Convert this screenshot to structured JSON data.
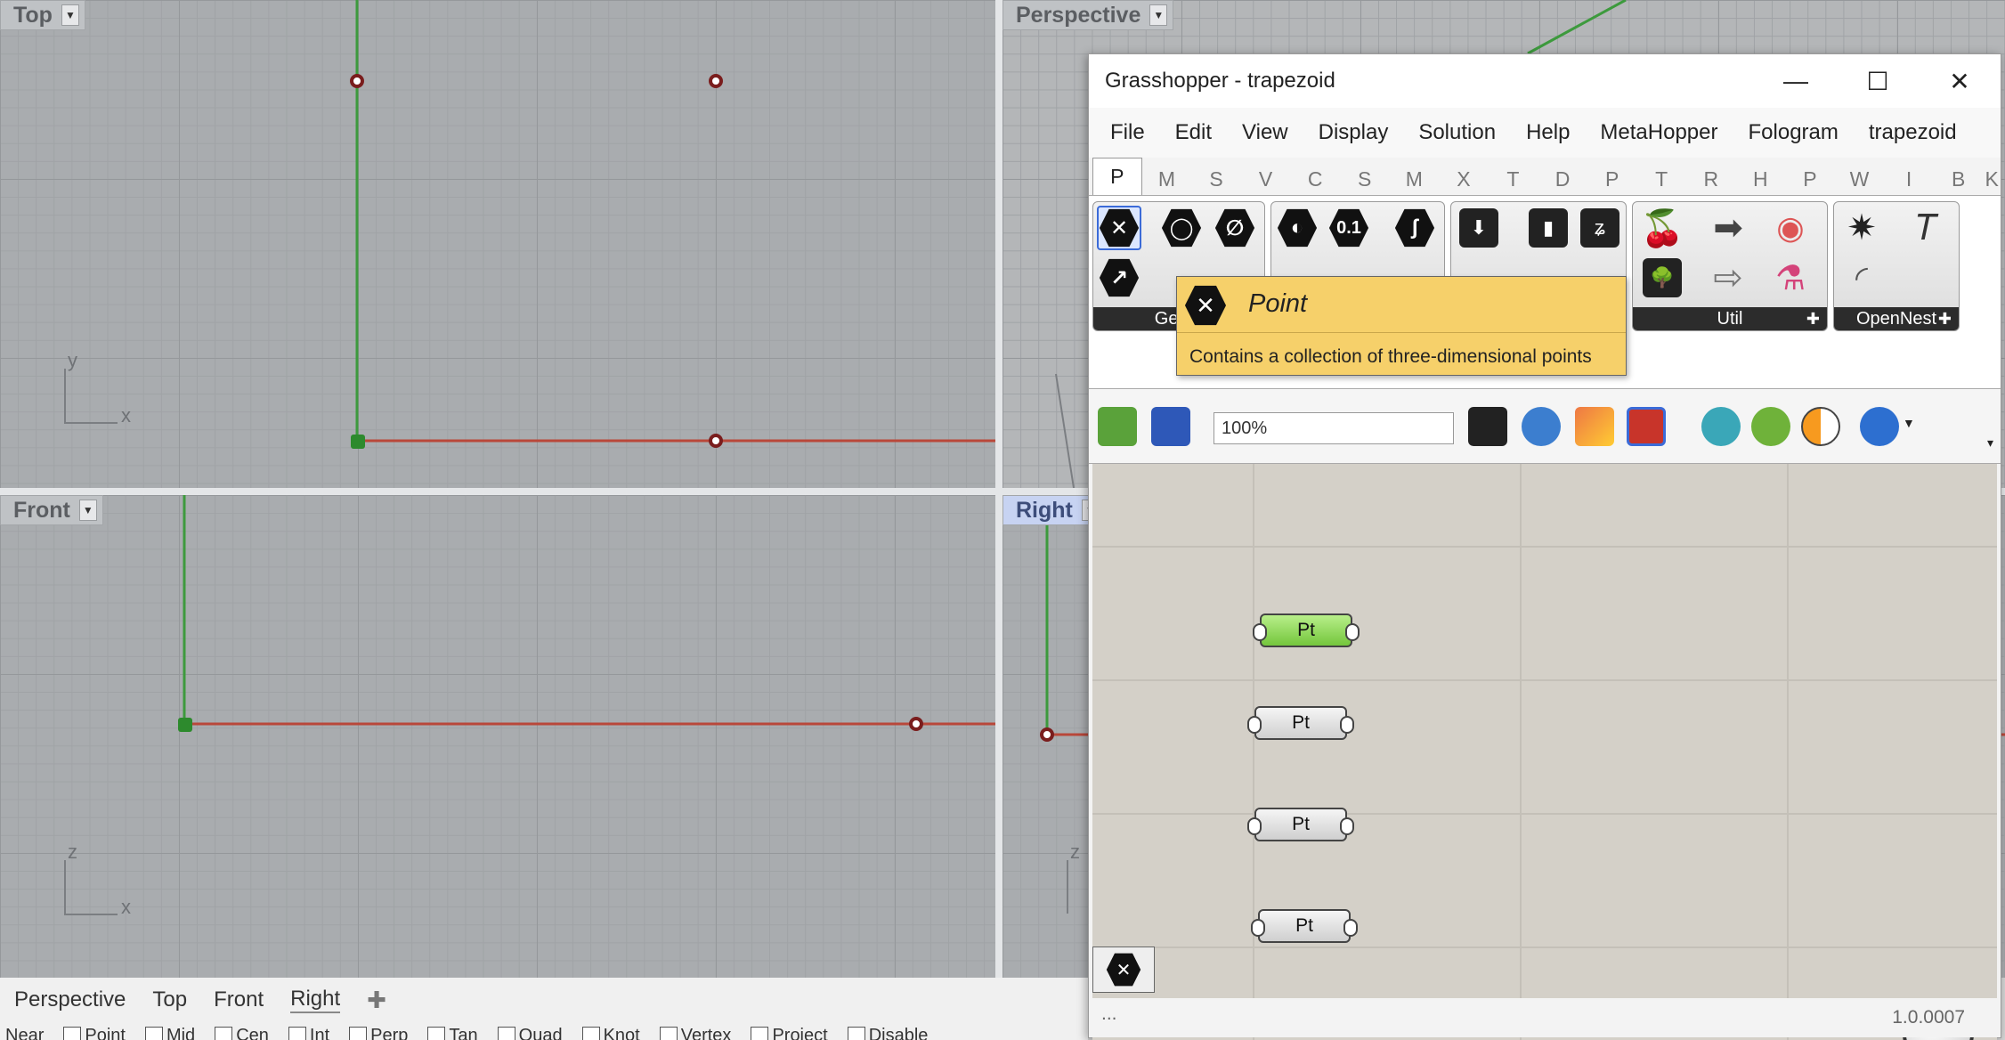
{
  "viewports": {
    "top": {
      "label": "Top",
      "axis_y": "y",
      "axis_x": "x"
    },
    "perspective": {
      "label": "Perspective"
    },
    "front": {
      "label": "Front",
      "axis_y": "z",
      "axis_x": "x"
    },
    "right": {
      "label": "Right",
      "axis_y": "z"
    }
  },
  "viewport_tabs": [
    "Perspective",
    "Top",
    "Front",
    "Right"
  ],
  "add_tab_icon": "plus-icon",
  "osnap": [
    "Near",
    "Point",
    "Mid",
    "Cen",
    "Int",
    "Perp",
    "Tan",
    "Quad",
    "Knot",
    "Vertex",
    "Project",
    "Disable"
  ],
  "colors": {
    "x_axis": "#b9473a",
    "y_axis": "#3d9a3d",
    "control_point": "#7a1d1d",
    "tooltip": "#f6d06a",
    "selected_component": "#8fd65a"
  },
  "gh": {
    "title": "Grasshopper - trapezoid",
    "window_buttons": {
      "minimize": "—",
      "maximize": "☐",
      "close": "✕"
    },
    "menu": [
      "File",
      "Edit",
      "View",
      "Display",
      "Solution",
      "Help",
      "MetaHopper",
      "Fologram",
      "trapezoid"
    ],
    "tabs": [
      "P",
      "M",
      "S",
      "V",
      "C",
      "S",
      "M",
      "X",
      "T",
      "D",
      "P",
      "T",
      "R",
      "H",
      "P",
      "W",
      "I",
      "B",
      "K"
    ],
    "ribbon_groups": [
      "Geom",
      "Util",
      "OpenNest"
    ],
    "ribbon_number_icon": "0.1",
    "tooltip": {
      "title": "Point",
      "description": "Contains a collection of three-dimensional points"
    },
    "zoom": "100%",
    "components": [
      "Pt",
      "Pt",
      "Pt",
      "Pt"
    ],
    "status_left": "...",
    "version": "1.0.0007"
  }
}
